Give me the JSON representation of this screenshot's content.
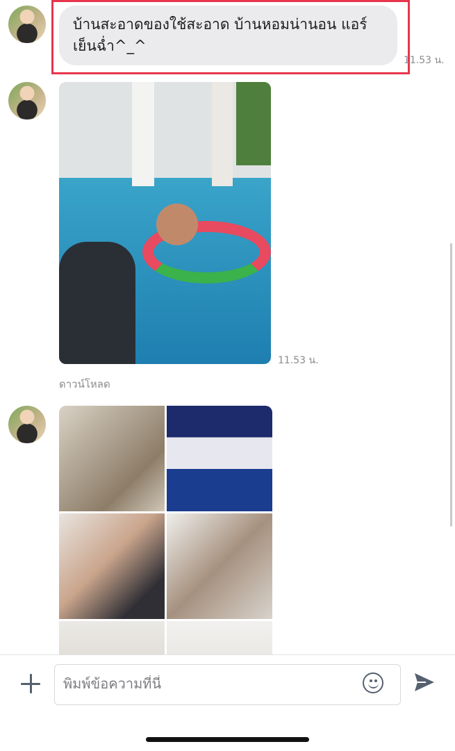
{
  "messages": [
    {
      "type": "text",
      "text": "บ้านสะอาดของใช้สะอาด บ้านหอมน่านอน แอร์เย็นฉ่ำ^_^",
      "time": "11.53 น."
    },
    {
      "type": "photo",
      "time": "11.53 น.",
      "action": "ดาวน์โหลด"
    },
    {
      "type": "album",
      "count_visible": 6
    }
  ],
  "input": {
    "placeholder": "พิมพ์ข้อความที่นี่"
  },
  "icons": {
    "add": "plus-icon",
    "emoji": "smiley-icon",
    "send": "send-icon"
  },
  "colors": {
    "highlight": "#e8344c",
    "bubble": "#ebebed",
    "icon": "#56606f"
  }
}
